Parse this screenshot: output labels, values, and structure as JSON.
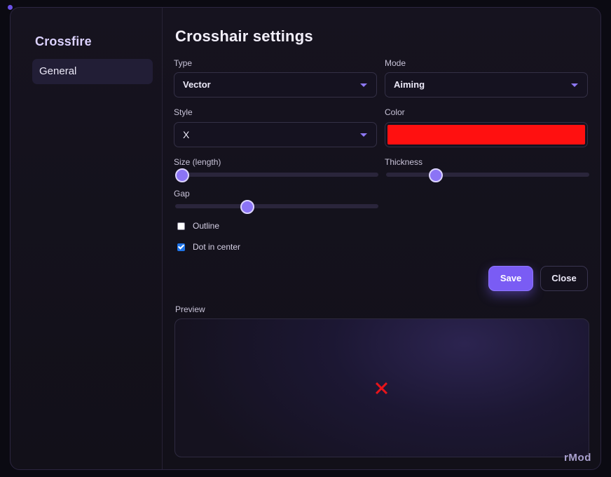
{
  "app": {
    "brand": "Crossfire",
    "footer_brand": "rMod"
  },
  "sidebar": {
    "items": [
      {
        "label": "General",
        "active": true
      }
    ]
  },
  "main": {
    "title": "Crosshair settings",
    "fields": {
      "type": {
        "label": "Type",
        "value": "Vector"
      },
      "mode": {
        "label": "Mode",
        "value": "Aiming"
      },
      "style": {
        "label": "Style",
        "value": "X"
      },
      "color": {
        "label": "Color",
        "value": "#ff1010"
      }
    },
    "sliders": {
      "size": {
        "label": "Size (length)",
        "fraction": 0.03
      },
      "thickness": {
        "label": "Thickness",
        "fraction": 0.24
      },
      "gap": {
        "label": "Gap",
        "fraction": 0.35
      }
    },
    "checkboxes": {
      "outline": {
        "label": "Outline",
        "checked": false
      },
      "dot": {
        "label": "Dot in center",
        "checked": true
      }
    },
    "buttons": {
      "save": "Save",
      "close": "Close"
    },
    "preview": {
      "label": "Preview",
      "crosshair_style": "X",
      "crosshair_color": "#e8141a"
    }
  },
  "colors": {
    "accent": "#7a5cf4",
    "background": "#121019",
    "checkbox_checked": "#1f74e8"
  }
}
